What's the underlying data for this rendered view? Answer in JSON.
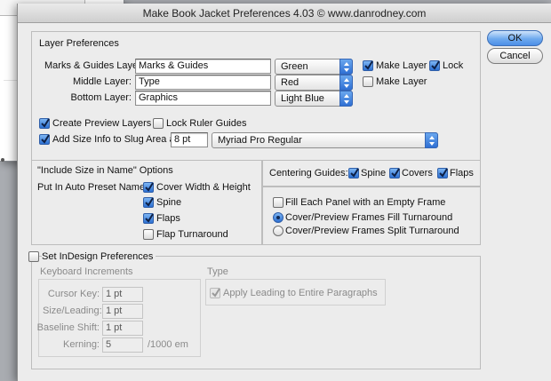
{
  "window": {
    "title": "Make Book Jacket Preferences 4.03 © www.danrodney.com"
  },
  "buttons": {
    "ok": "OK",
    "cancel": "Cancel"
  },
  "layer_prefs": {
    "title": "Layer Preferences",
    "marks": {
      "label": "Marks & Guides Layer:",
      "value": "Marks & Guides",
      "color": "Green"
    },
    "middle": {
      "label": "Middle Layer:",
      "value": "Type",
      "color": "Red"
    },
    "bottom": {
      "label": "Bottom Layer:",
      "value": "Graphics",
      "color": "Light Blue"
    },
    "make_layer_1": "Make Layer",
    "lock": "Lock",
    "make_layer_2": "Make Layer",
    "checks": {
      "make_layer_1": true,
      "lock": true,
      "make_layer_2": false
    }
  },
  "preview": {
    "create_preview": "Create Preview Layers",
    "lock_ruler": "Lock Ruler Guides",
    "add_size": "Add Size Info to Slug Area as:",
    "size_value": "8 pt",
    "font_value": "Myriad Pro    Regular",
    "checks": {
      "create_preview": true,
      "lock_ruler": false,
      "add_size": true
    }
  },
  "include_size": {
    "title": "\"Include Size in Name\" Options",
    "auto_preset_label": "Put In Auto Preset Name:",
    "cover": "Cover Width & Height",
    "spine": "Spine",
    "flaps": "Flaps",
    "flap_turnaround": "Flap Turnaround",
    "checks": {
      "cover": true,
      "spine": true,
      "flaps": true,
      "flap_turnaround": false
    }
  },
  "centering": {
    "label": "Centering Guides:",
    "spine": "Spine",
    "covers": "Covers",
    "flaps": "Flaps",
    "checks": {
      "spine": true,
      "covers": true,
      "flaps": true
    }
  },
  "frames": {
    "fill_panel": "Fill Each Panel with an Empty Frame",
    "fill_turnaround": "Cover/Preview Frames Fill Turnaround",
    "split_turnaround": "Cover/Preview Frames Split Turnaround",
    "fill_panel_checked": false,
    "selected": "fill_turnaround"
  },
  "indesign": {
    "title": "Set InDesign Preferences",
    "checked": false,
    "keyboard_title": "Keyboard Increments",
    "cursor_key_label": "Cursor Key:",
    "cursor_key": "1 pt",
    "size_leading_label": "Size/Leading:",
    "size_leading": "1 pt",
    "baseline_label": "Baseline Shift:",
    "baseline": "1 pt",
    "kerning_label": "Kerning:",
    "kerning": "5",
    "kerning_unit": "/1000 em",
    "type_title": "Type",
    "apply_leading": "Apply Leading to Entire Paragraphs",
    "apply_leading_checked": true
  },
  "colors": {
    "accent": "#2c6fd2",
    "dialog_bg": "#ececec"
  }
}
